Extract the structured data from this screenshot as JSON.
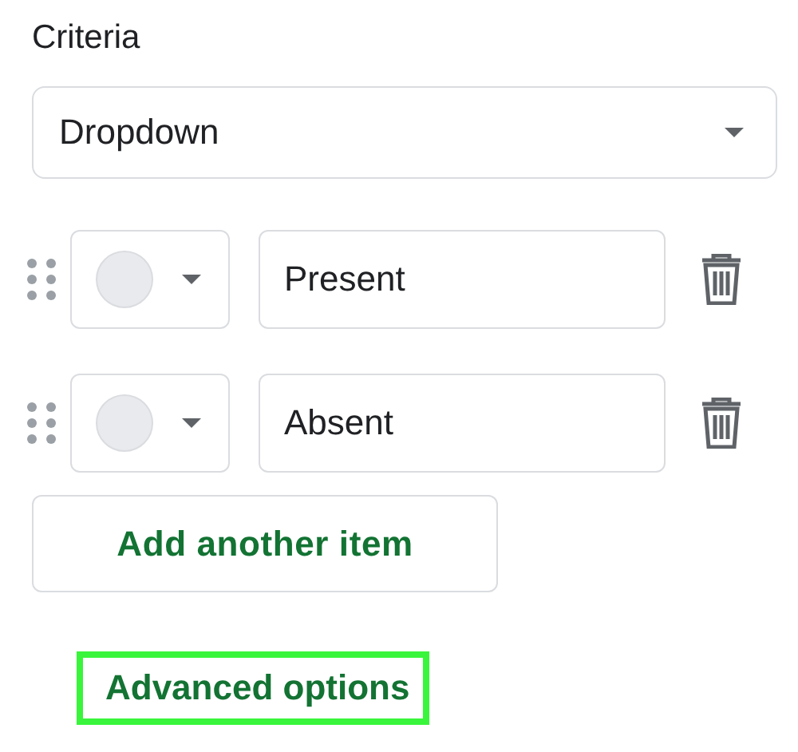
{
  "criteria": {
    "label": "Criteria",
    "value": "Dropdown"
  },
  "items": [
    {
      "value": "Present"
    },
    {
      "value": "Absent"
    }
  ],
  "add_button": "Add another item",
  "advanced_link": {
    "label": "Advanced options",
    "highlighted": true
  }
}
